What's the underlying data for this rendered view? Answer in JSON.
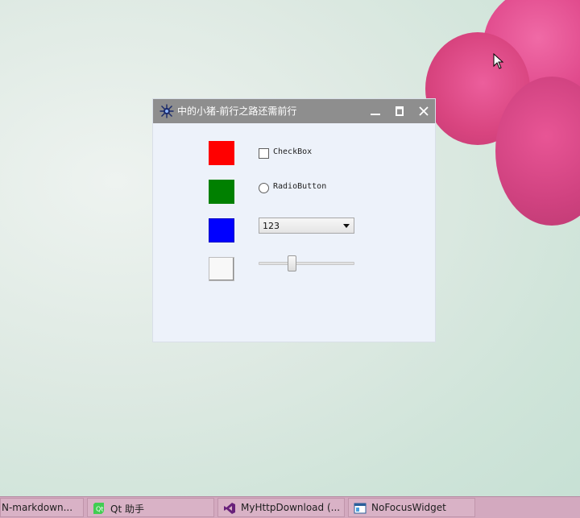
{
  "window": {
    "title": "中的小猪-前行之路还需前行",
    "controls": [
      "minimize",
      "maximize",
      "close"
    ]
  },
  "widgets": {
    "swatches": [
      {
        "name": "red",
        "color": "#ff0000"
      },
      {
        "name": "green",
        "color": "#008000"
      },
      {
        "name": "blue",
        "color": "#0000ff"
      },
      {
        "name": "white",
        "color": "#f8f8f8"
      }
    ],
    "checkbox": {
      "label": "CheckBox",
      "checked": false
    },
    "radio": {
      "label": "RadioButton",
      "checked": false
    },
    "combo": {
      "value": "123"
    },
    "slider": {
      "value_fraction": 0.33
    }
  },
  "taskbar": {
    "items": [
      {
        "label": "N-markdown...",
        "icon": "document-icon"
      },
      {
        "label": "Qt 助手",
        "icon": "qt-icon"
      },
      {
        "label": "MyHttpDownload (...",
        "icon": "visual-studio-icon"
      },
      {
        "label": "NoFocusWidget",
        "icon": "window-app-icon"
      }
    ]
  },
  "colors": {
    "titlebar": "#8e8e8e",
    "window_bg": "#edf2fa",
    "taskbar": "#d3a9bf"
  }
}
